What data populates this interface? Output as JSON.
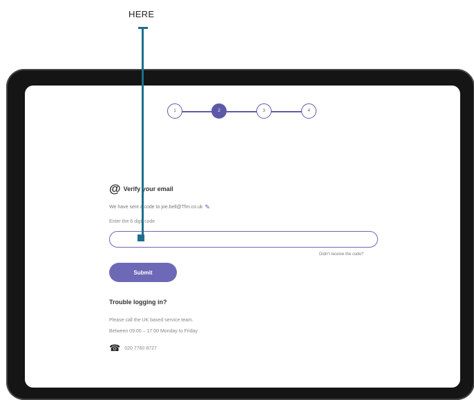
{
  "callout": {
    "label": "HERE"
  },
  "stepper": {
    "steps": [
      "1",
      "2",
      "3",
      "4"
    ],
    "active_step": 2
  },
  "verify": {
    "icon": "at-icon",
    "title": "Verify your email",
    "sent_text": "We have sent a code to joe.bell@Tfm.co.uk",
    "edit_icon": "pencil-icon"
  },
  "code": {
    "label": "Enter the 6 digit code",
    "value": "",
    "placeholder": "",
    "resend_link": "Didn't receive the code?"
  },
  "submit": {
    "label": "Submit"
  },
  "help": {
    "title": "Trouble logging in?",
    "line1": "Please call the UK based service team.",
    "line2": "Between 09:00 – 17:00 Monday to Friday",
    "phone_icon": "phone-icon",
    "phone": "020 7760 8727"
  },
  "colors": {
    "accent": "#6e69b6",
    "callout": "#1e6e8c",
    "device_frame": "#151515"
  }
}
